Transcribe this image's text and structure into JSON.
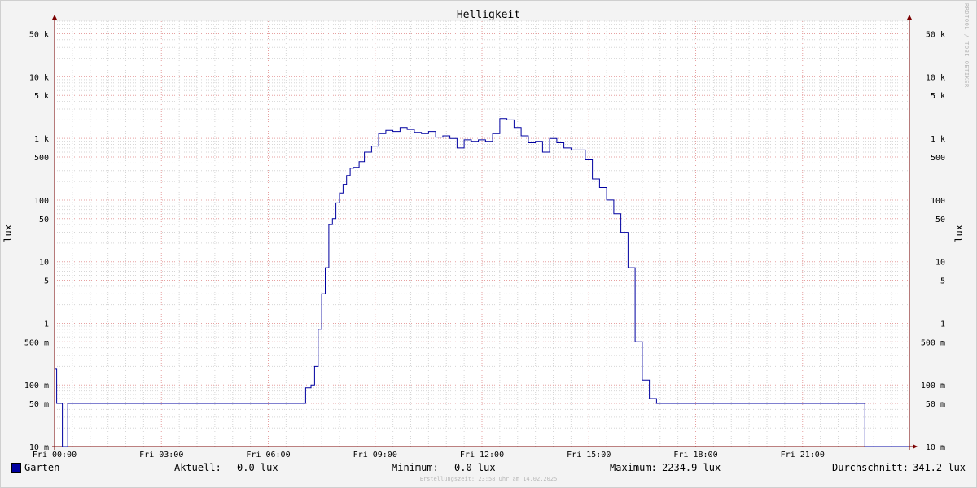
{
  "colors": {
    "background": "#f3f3f3",
    "plot_background": "#ffffff",
    "major_grid": "#e6a0a0",
    "minor_grid": "#d6d6d6",
    "series_line": "#0000a0",
    "axis": "#7a0000"
  },
  "header": {
    "title": "Helligkeit",
    "watermark": "RRDTOOL / TOBI OETIKER"
  },
  "axes": {
    "ylabel_left": "lux",
    "ylabel_right": "lux"
  },
  "legend": {
    "series_name": "Garten",
    "current_label": "Aktuell:",
    "current_value": "0.0 lux",
    "min_label": "Minimum:",
    "min_value": "0.0 lux",
    "max_label": "Maximum:",
    "max_value": "2234.9 lux",
    "avg_label": "Durchschnitt:",
    "avg_value": "341.2 lux"
  },
  "footer": {
    "created": "Erstellungszeit: 23:58 Uhr am 14.02.2025"
  },
  "chart_data": {
    "type": "line",
    "title": "Helligkeit",
    "xlabel": "",
    "ylabel": "lux",
    "y_scale": "log",
    "ylim": [
      0.01,
      80000
    ],
    "xlim_hours": [
      0,
      24
    ],
    "y_ticks": [
      {
        "value": 0.01,
        "label": "10 m"
      },
      {
        "value": 0.05,
        "label": "50 m"
      },
      {
        "value": 0.1,
        "label": "100 m"
      },
      {
        "value": 0.5,
        "label": "500 m"
      },
      {
        "value": 1,
        "label": "1"
      },
      {
        "value": 5,
        "label": "5"
      },
      {
        "value": 10,
        "label": "10"
      },
      {
        "value": 50,
        "label": "50"
      },
      {
        "value": 100,
        "label": "100"
      },
      {
        "value": 500,
        "label": "500"
      },
      {
        "value": 1000,
        "label": "1 k"
      },
      {
        "value": 5000,
        "label": "5 k"
      },
      {
        "value": 10000,
        "label": "10 k"
      },
      {
        "value": 50000,
        "label": "50 k"
      }
    ],
    "x_ticks": [
      {
        "value": 0,
        "label": "Fri 00:00"
      },
      {
        "value": 3,
        "label": "Fri 03:00"
      },
      {
        "value": 6,
        "label": "Fri 06:00"
      },
      {
        "value": 9,
        "label": "Fri 09:00"
      },
      {
        "value": 12,
        "label": "Fri 12:00"
      },
      {
        "value": 15,
        "label": "Fri 15:00"
      },
      {
        "value": 18,
        "label": "Fri 18:00"
      },
      {
        "value": 21,
        "label": "Fri 21:00"
      }
    ],
    "grid": true,
    "series": [
      {
        "name": "Garten",
        "color": "#0000a0",
        "x": [
          0.0,
          0.03,
          0.06,
          0.12,
          0.18,
          0.22,
          0.33,
          0.37,
          7.0,
          7.05,
          7.2,
          7.3,
          7.4,
          7.5,
          7.6,
          7.7,
          7.8,
          7.9,
          8.0,
          8.1,
          8.2,
          8.3,
          8.4,
          8.55,
          8.7,
          8.9,
          9.1,
          9.3,
          9.5,
          9.7,
          9.9,
          10.1,
          10.3,
          10.5,
          10.7,
          10.9,
          11.1,
          11.3,
          11.5,
          11.7,
          11.9,
          12.1,
          12.3,
          12.5,
          12.7,
          12.9,
          13.1,
          13.3,
          13.5,
          13.7,
          13.9,
          14.1,
          14.3,
          14.5,
          14.7,
          14.9,
          15.1,
          15.3,
          15.5,
          15.7,
          15.9,
          16.1,
          16.3,
          16.5,
          16.7,
          16.9,
          17.1,
          17.3,
          17.5,
          17.65,
          17.8,
          17.9,
          18.0,
          18.1,
          18.2,
          18.3,
          18.5,
          22.7,
          22.75,
          24.0
        ],
        "y": [
          0.18,
          0.18,
          0.05,
          0.05,
          0.05,
          0.01,
          0.01,
          0.05,
          0.05,
          0.09,
          0.1,
          0.2,
          0.8,
          3,
          8,
          40,
          50,
          90,
          130,
          180,
          250,
          330,
          340,
          420,
          600,
          750,
          1200,
          1350,
          1300,
          1500,
          1400,
          1250,
          1200,
          1300,
          1050,
          1100,
          1000,
          700,
          950,
          900,
          950,
          900,
          1200,
          2100,
          2000,
          1500,
          1100,
          850,
          900,
          600,
          1000,
          850,
          700,
          650,
          650,
          450,
          220,
          160,
          100,
          60,
          30,
          8,
          0.5,
          0.12,
          0.06,
          0.05,
          0.05,
          0.05,
          0.05,
          0.05,
          0.05,
          0.05,
          0.05,
          0.05,
          0.05,
          0.05,
          0.05,
          0.05,
          0.01,
          0.01
        ]
      }
    ]
  }
}
